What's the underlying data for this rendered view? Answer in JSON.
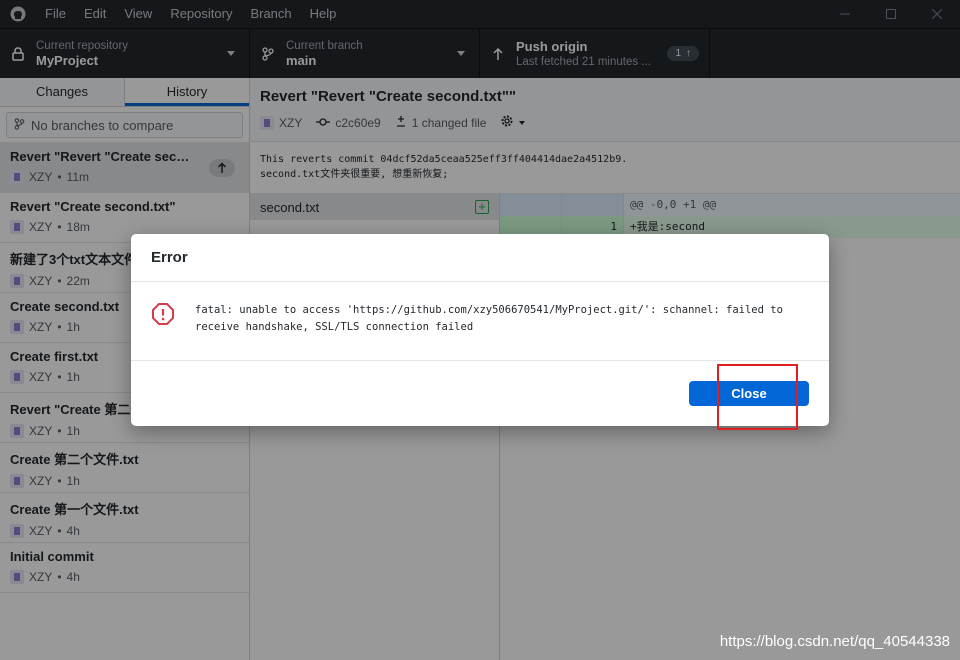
{
  "menu": [
    "File",
    "Edit",
    "View",
    "Repository",
    "Branch",
    "Help"
  ],
  "toolbar": {
    "repo_label": "Current repository",
    "repo_value": "MyProject",
    "branch_label": "Current branch",
    "branch_value": "main",
    "push_label": "Push origin",
    "push_sub": "Last fetched 21 minutes ...",
    "push_count": "1"
  },
  "sidebar": {
    "tabs": [
      "Changes",
      "History"
    ],
    "compare_placeholder": "No branches to compare",
    "commits": [
      {
        "title": "Revert \"Revert \"Create seco...",
        "author": "XZY",
        "time": "11m"
      },
      {
        "title": "Revert \"Create second.txt\"",
        "author": "XZY",
        "time": "18m"
      },
      {
        "title": "新建了3个txt文本文件",
        "author": "XZY",
        "time": "22m"
      },
      {
        "title": "Create second.txt",
        "author": "XZY",
        "time": "1h"
      },
      {
        "title": "Create first.txt",
        "author": "XZY",
        "time": "1h"
      },
      {
        "title": "Revert \"Create 第二个",
        "author": "XZY",
        "time": "1h"
      },
      {
        "title": "Create 第二个文件.txt",
        "author": "XZY",
        "time": "1h"
      },
      {
        "title": "Create 第一个文件.txt",
        "author": "XZY",
        "time": "4h"
      },
      {
        "title": "Initial commit",
        "author": "XZY",
        "time": "4h"
      }
    ]
  },
  "commit": {
    "heading": "Revert \"Revert \"Create second.txt\"\"",
    "author": "XZY",
    "sha": "c2c60e9",
    "changed": "1 changed file",
    "body_line1": "This reverts commit 04dcf52da5ceaa525eff3ff404414dae2a4512b9.",
    "body_line2": "second.txt文件夹很重要, 想重新恢复;"
  },
  "files": [
    {
      "name": "second.txt"
    }
  ],
  "diff": {
    "hunk": "@@ -0,0 +1 @@",
    "line_no": "1",
    "line_code": "+我是:second"
  },
  "dialog": {
    "title": "Error",
    "message_line1": "fatal: unable to access 'https://github.com/xzy506670541/MyProject.git/': schannel: failed to",
    "message_line2": "receive handshake, SSL/TLS connection failed",
    "close_label": "Close"
  },
  "watermark": "https://blog.csdn.net/qq_40544338",
  "colors": {
    "accent": "#0366d6",
    "error": "#d73a49",
    "highlight": "#e02020"
  }
}
